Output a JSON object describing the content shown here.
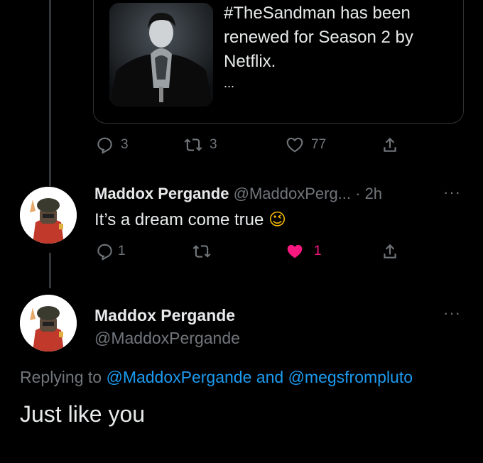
{
  "quoted_tweet": {
    "text": "#TheSandman has been renewed for Season 2 by Netflix.",
    "ellipsis": "...",
    "actions": {
      "replies": "3",
      "retweets": "3",
      "likes": "77"
    }
  },
  "reply_tweet": {
    "display_name": "Maddox Pergande",
    "handle_time": "@MaddoxPerg... · 2h",
    "text": "It’s a dream come true",
    "emoji": "😉",
    "actions": {
      "replies": "1",
      "likes": "1"
    },
    "like_color": "#f91880"
  },
  "main_tweet": {
    "display_name": "Maddox Pergande",
    "handle": "@MaddoxPergande",
    "replying_prefix": "Replying to",
    "reply_user_1": "@MaddoxPergande",
    "reply_and": "and",
    "reply_user_2": "@megsfrompluto",
    "text": "Just like you"
  },
  "colors": {
    "background": "#000000",
    "text": "#e7e9ea",
    "muted": "#71767b",
    "link": "#1d9bf0"
  }
}
